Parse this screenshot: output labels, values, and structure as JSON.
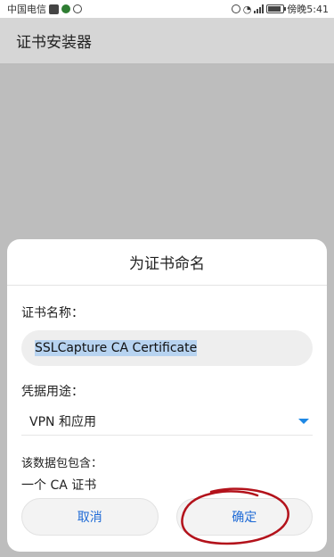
{
  "status_bar": {
    "carrier": "中国电信",
    "time": "傍晚5:41"
  },
  "app_bar": {
    "title": "证书安装器"
  },
  "dialog": {
    "title": "为证书命名",
    "name_label": "证书名称：",
    "name_value": "SSLCapture CA Certificate",
    "use_label": "凭据用途：",
    "use_value": "VPN 和应用",
    "contains_label": "该数据包包含：",
    "contains_value": "一个 CA 证书",
    "cancel_label": "取消",
    "ok_label": "确定"
  },
  "colors": {
    "accent": "#1e88e5",
    "annotation": "#b3121b"
  }
}
